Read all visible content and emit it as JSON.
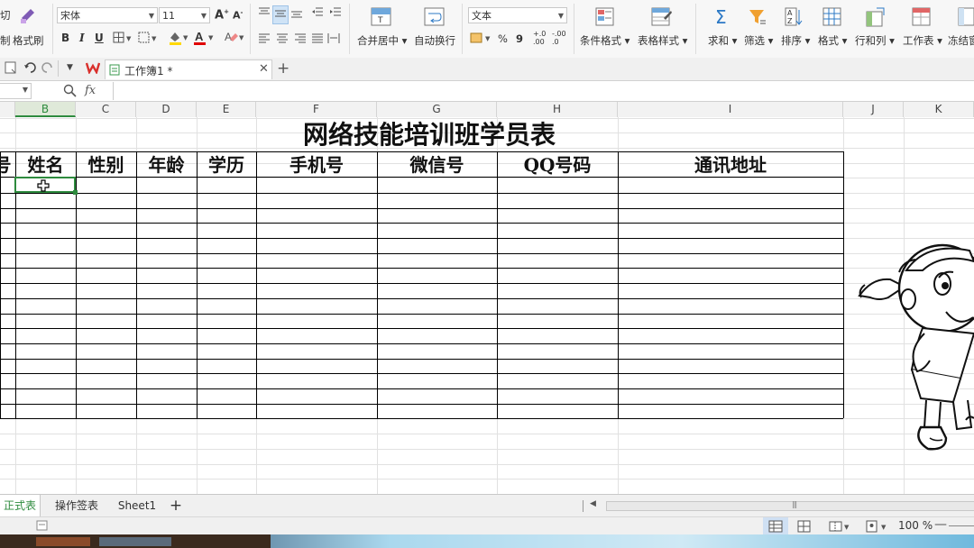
{
  "ribbon": {
    "clipboard": {
      "cut_label": "切",
      "copy_label": "制",
      "format_painter_label": "格式刷"
    },
    "font": {
      "name": "宋体",
      "size": "11",
      "bold": "B",
      "italic": "I",
      "underline": "U",
      "grow": "A",
      "shrink": "A"
    },
    "align": {
      "merge_label": "合并居中",
      "wrap_label": "自动换行"
    },
    "number": {
      "format": "文本",
      "percent": "%",
      "comma": "9",
      "inc_decimal": "+.0\n.00",
      "dec_decimal": "-.00\n.0"
    },
    "styles": {
      "conditional_label": "条件格式",
      "table_style_label": "表格样式"
    },
    "editing": {
      "sum_label": "求和",
      "filter_label": "筛选",
      "sort_label": "排序",
      "format_label": "格式",
      "rowcol_label": "行和列",
      "worksheet_label": "工作表",
      "freeze_label": "冻结窗"
    }
  },
  "doc_tabs": {
    "active_title": "工作簿1 *",
    "new_tab": "+"
  },
  "formula_bar": {
    "name_box": "",
    "fx": "fx",
    "value": ""
  },
  "columns": [
    "B",
    "C",
    "D",
    "E",
    "F",
    "G",
    "H",
    "I",
    "J",
    "K"
  ],
  "sheet": {
    "title": "网络技能培训班学员表",
    "headers": [
      "号",
      "姓名",
      "性别",
      "年龄",
      "学历",
      "手机号",
      "微信号",
      "QQ号码",
      "通讯地址"
    ]
  },
  "sheet_tabs": [
    "正式表",
    "操作签表",
    "Sheet1"
  ],
  "add_sheet": "+",
  "status": {
    "zoom": "100 %"
  },
  "colors": {
    "accent_green": "#217346",
    "active_tab_text": "#2e8b3e",
    "selection": "#2e8b3e"
  }
}
